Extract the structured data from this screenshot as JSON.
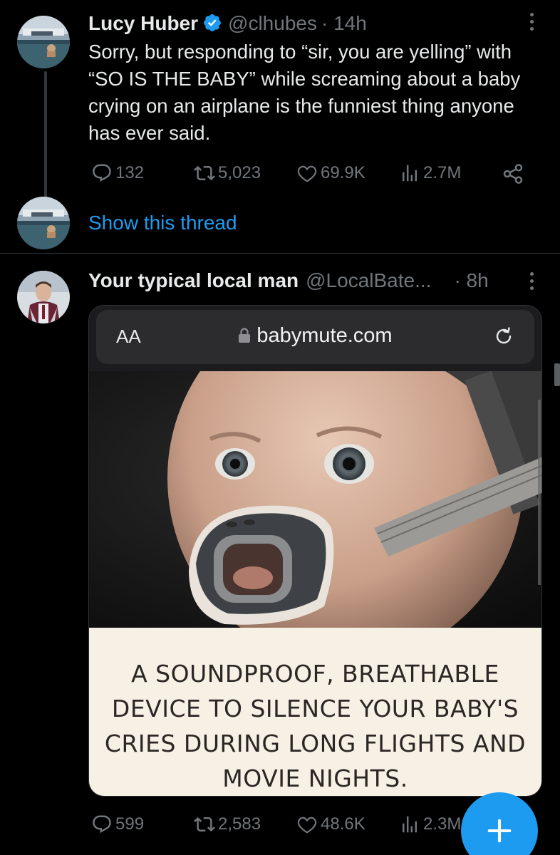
{
  "tweet1": {
    "name": "Lucy Huber",
    "handle": "@clhubes",
    "time": "· 14h",
    "text": "Sorry, but responding to “sir, you are yelling” with “SO IS THE BABY” while screaming about a baby crying on an airplane is the funniest thing anyone has ever said.",
    "replies": "132",
    "retweets": "5,023",
    "likes": "69.9K",
    "views": "2.7M",
    "show_thread": "Show this thread"
  },
  "tweet2": {
    "name": "Your typical local man",
    "handle": "@LocalBate...",
    "time": "· 8h",
    "browser": {
      "aa": "AA",
      "url": "babymute.com"
    },
    "caption": "A SOUNDPROOF, BREATHABLE DEVICE TO SILENCE YOUR BABY'S CRIES DURING LONG FLIGHTS AND MOVIE NIGHTS.",
    "replies": "599",
    "retweets": "2,583",
    "likes": "48.6K",
    "views": "2.3M"
  },
  "colors": {
    "background": "#000000",
    "text": "#e7e9ea",
    "muted": "#71767b",
    "accent": "#1d9bf0",
    "caption_bg": "#f7f1e5"
  },
  "icons": [
    "verified-icon",
    "more-icon",
    "reply-icon",
    "retweet-icon",
    "like-icon",
    "views-icon",
    "share-icon",
    "lock-icon",
    "reload-icon",
    "compose-icon"
  ]
}
